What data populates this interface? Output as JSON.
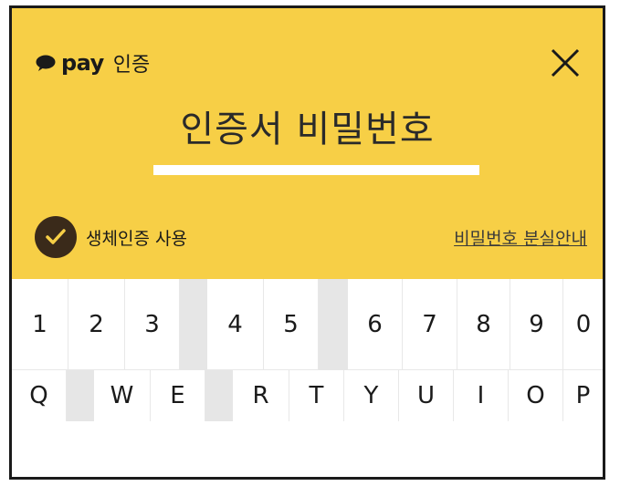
{
  "header": {
    "brand_pay": "pay",
    "brand_auth": "인증",
    "title": "인증서 비밀번호",
    "close_icon": "close-icon",
    "bubble_icon": "speech-bubble-icon",
    "bg_color": "#f7cf46"
  },
  "biometric": {
    "label": "생체인증 사용",
    "checked": true,
    "icon": "checkmark-icon"
  },
  "forgot_link": "비밀번호 분실안내",
  "keyboard": {
    "numbers": [
      "1",
      "2",
      "3",
      "4",
      "5",
      "6",
      "7",
      "8",
      "9",
      "0"
    ],
    "letters": [
      "Q",
      "W",
      "E",
      "R",
      "T",
      "Y",
      "U",
      "I",
      "O",
      "P"
    ]
  }
}
